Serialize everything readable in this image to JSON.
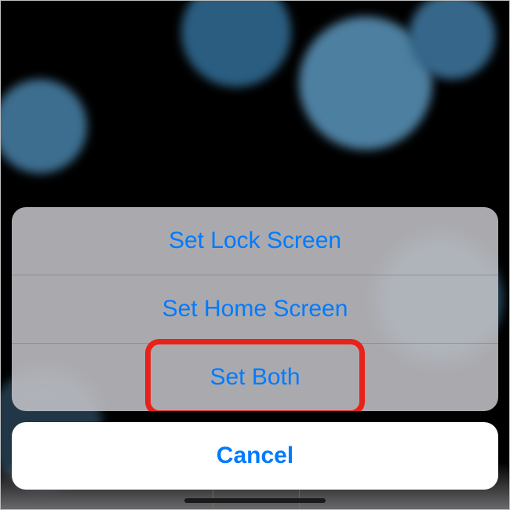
{
  "actions": {
    "set_lock": "Set Lock Screen",
    "set_home": "Set Home Screen",
    "set_both": "Set Both"
  },
  "cancel": "Cancel"
}
